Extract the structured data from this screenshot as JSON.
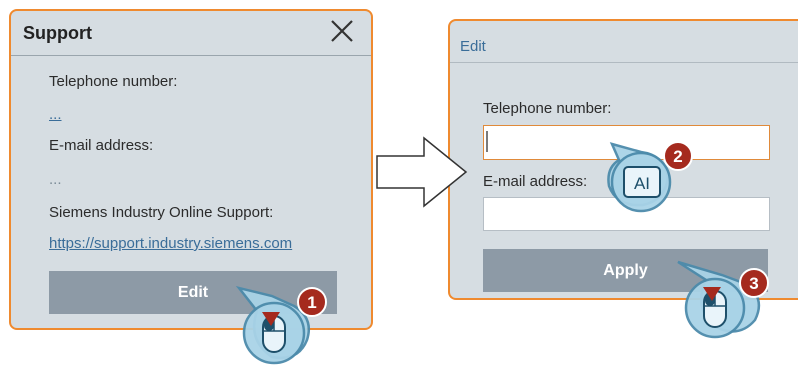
{
  "support_dialog": {
    "title": "Support",
    "telephone_label": "Telephone number:",
    "telephone_value": "...",
    "email_label": "E-mail address:",
    "email_value": "...",
    "online_support_label": "Siemens Industry Online Support:",
    "online_support_link": "https://support.industry.siemens.com",
    "edit_button": "Edit"
  },
  "edit_dialog": {
    "title": "Edit",
    "telephone_label": "Telephone number:",
    "telephone_value": "",
    "email_label": "E-mail address:",
    "email_value": "",
    "apply_button": "Apply"
  },
  "callouts": [
    {
      "number": "1",
      "icon": "mouse-click-icon"
    },
    {
      "number": "2",
      "icon": "text-input-icon",
      "icon_text": "AI"
    },
    {
      "number": "3",
      "icon": "mouse-click-icon"
    }
  ],
  "colors": {
    "panel_bg": "#d6dde2",
    "panel_border": "#ef8a2f",
    "button_bg": "#8d9aa6",
    "badge_bg": "#a52a1e",
    "callout_bg": "#a9d3e7",
    "callout_border": "#4c8bab",
    "link": "#3a6d99"
  }
}
